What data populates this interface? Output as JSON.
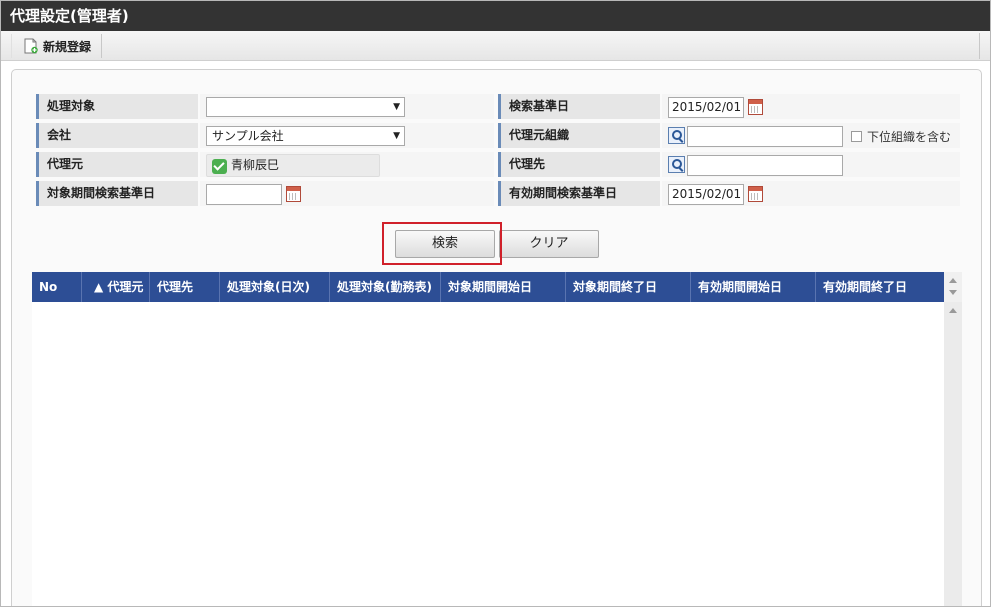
{
  "window": {
    "title": "代理設定(管理者)"
  },
  "toolbar": {
    "new_button_label": "新規登録",
    "new_button_icon": "new-document-icon"
  },
  "form": {
    "processing_target": {
      "label": "処理対象",
      "value": ""
    },
    "search_base_date": {
      "label": "検索基準日",
      "value": "2015/02/01"
    },
    "company": {
      "label": "会社",
      "value": "サンプル会社"
    },
    "delegator_org": {
      "label": "代理元組織",
      "value": "",
      "include_sub_label": "下位組織を含む"
    },
    "delegator": {
      "label": "代理元",
      "value": "青柳辰巳"
    },
    "delegate": {
      "label": "代理先",
      "value": ""
    },
    "target_period_date": {
      "label": "対象期間検索基準日",
      "value": ""
    },
    "valid_period_date": {
      "label": "有効期間検索基準日",
      "value": "2015/02/01"
    }
  },
  "actions": {
    "search_label": "検索",
    "clear_label": "クリア"
  },
  "grid": {
    "columns": [
      "No",
      "▲ 代理元",
      "代理先",
      "処理対象(日次)",
      "処理対象(勤務表)",
      "対象期間開始日",
      "対象期間終了日",
      "有効期間開始日",
      "有効期間終了日"
    ],
    "rows": []
  },
  "colors": {
    "titlebar": "#333333",
    "grid_header": "#2d4e95",
    "highlight": "#d0202a",
    "label_accent": "#6a8bb8"
  }
}
